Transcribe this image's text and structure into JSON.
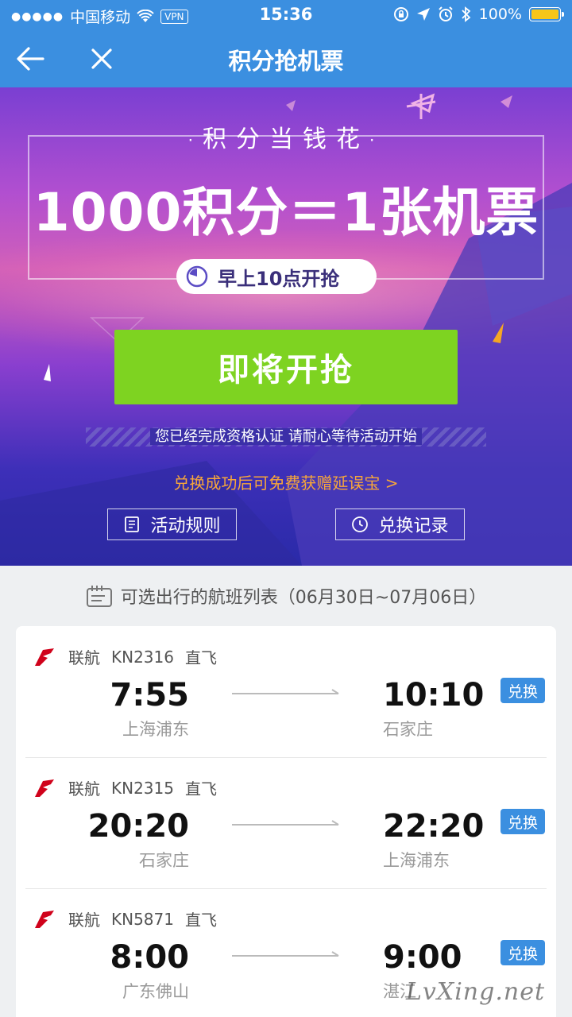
{
  "status_bar": {
    "carrier": "中国移动",
    "vpn": "VPN",
    "time": "15:36",
    "battery": "100%"
  },
  "nav": {
    "title": "积分抢机票"
  },
  "banner": {
    "slogan": "积分当钱花",
    "headline": "1000积分＝1张机票",
    "start_time": "早上10点开抢",
    "cta_label": "即将开抢",
    "notice": "您已经完成资格认证 请耐心等待活动开始",
    "promo": "兑换成功后可免费获赠延误宝 >",
    "rules_label": "活动规则",
    "history_label": "兑换记录"
  },
  "list": {
    "header": "可选出行的航班列表（06月30日~07月06日）",
    "flights": [
      {
        "airline": "联航",
        "flight_no": "KN2316",
        "type": "直飞",
        "dep_time": "7:55",
        "dep_city": "上海浦东",
        "arr_time": "10:10",
        "arr_city": "石家庄",
        "action": "兑换"
      },
      {
        "airline": "联航",
        "flight_no": "KN2315",
        "type": "直飞",
        "dep_time": "20:20",
        "dep_city": "石家庄",
        "arr_time": "22:20",
        "arr_city": "上海浦东",
        "action": "兑换"
      },
      {
        "airline": "联航",
        "flight_no": "KN5871",
        "type": "直飞",
        "dep_time": "8:00",
        "dep_city": "广东佛山",
        "arr_time": "9:00",
        "arr_city": "湛江",
        "action": "兑换"
      }
    ]
  },
  "watermark": "LvXing.net",
  "colors": {
    "nav_blue": "#3b8fe0",
    "cta_green": "#7ed321",
    "promo_orange": "#f7a63a",
    "battery_yellow": "#f6c619"
  }
}
